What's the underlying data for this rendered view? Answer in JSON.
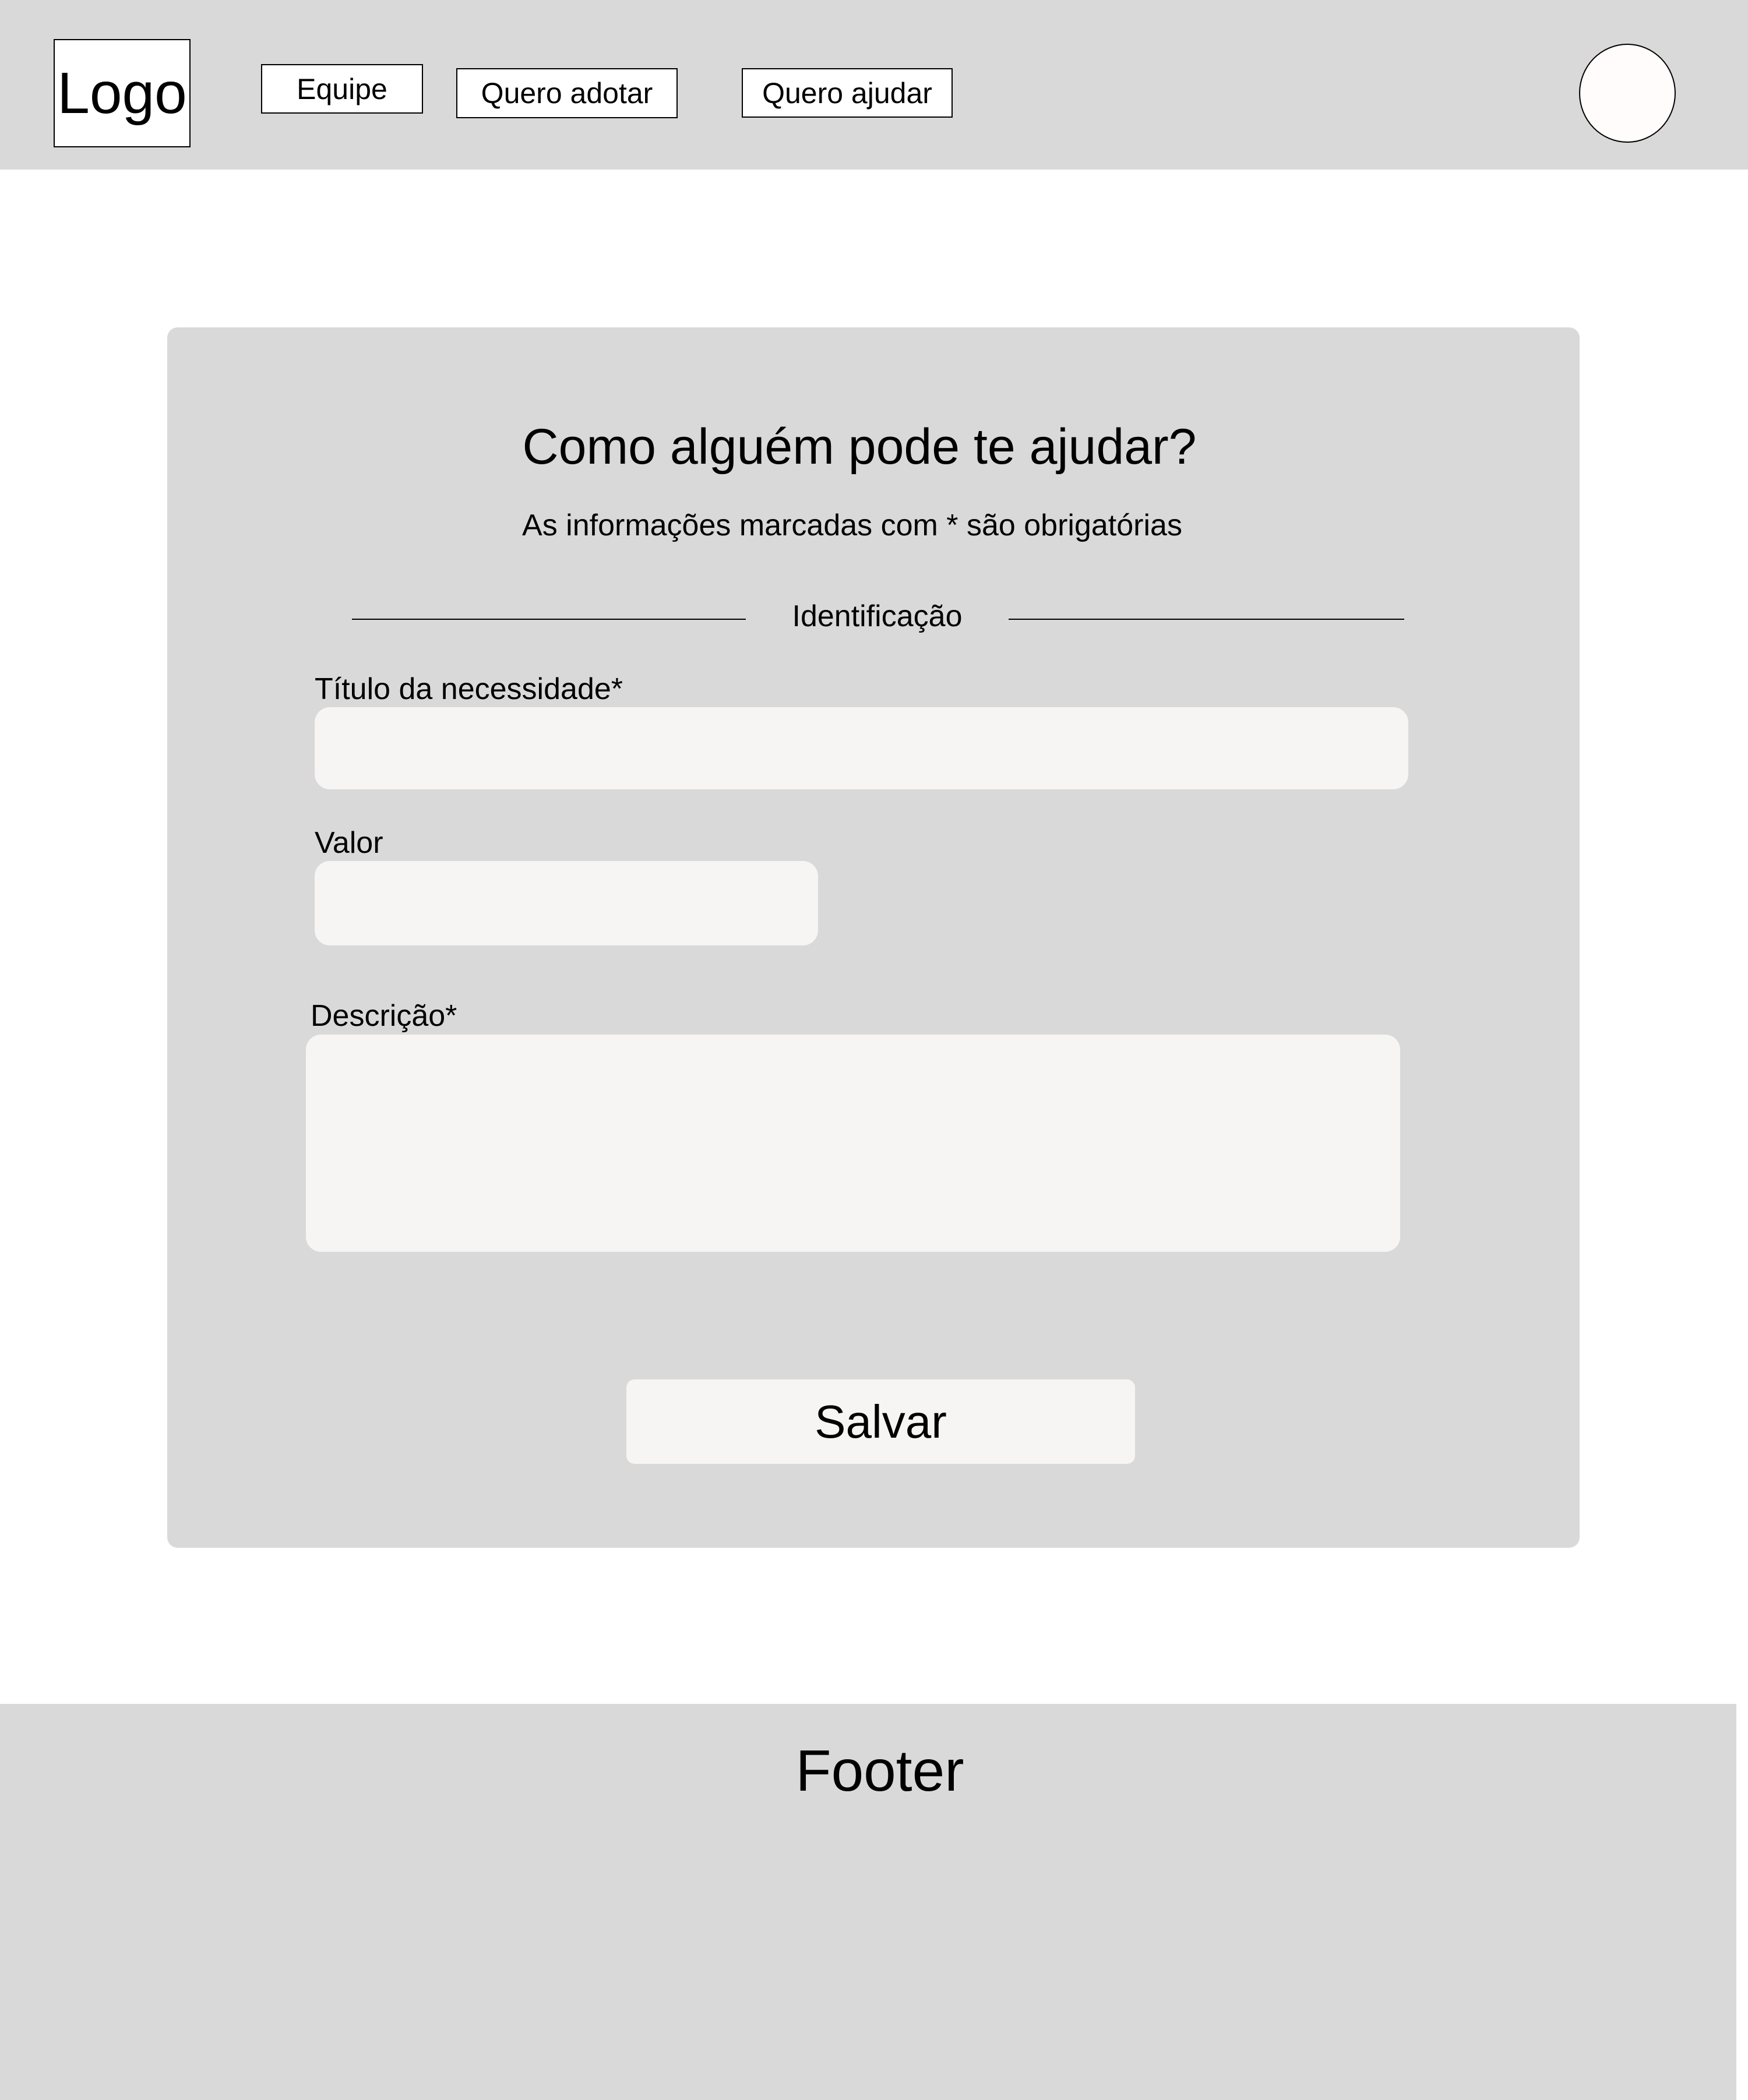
{
  "header": {
    "logo_text": "Logo",
    "nav": {
      "equipe": "Equipe",
      "quero_adotar": "Quero adotar",
      "quero_ajudar": "Quero ajudar"
    }
  },
  "form": {
    "title": "Como alguém pode te ajudar?",
    "subtitle": "As informações marcadas com * são obrigatórias",
    "section_label": "Identificação",
    "fields": {
      "titulo": {
        "label": "Título da necessidade*",
        "value": ""
      },
      "valor": {
        "label": "Valor",
        "value": ""
      },
      "descricao": {
        "label": "Descrição*",
        "value": ""
      }
    },
    "save_label": "Salvar"
  },
  "footer": {
    "text": "Footer"
  },
  "colors": {
    "header_bg": "#d9d9d9",
    "card_bg": "#d9d9d9",
    "input_bg": "#f6f5f4",
    "footer_bg": "#d9d9d9"
  }
}
